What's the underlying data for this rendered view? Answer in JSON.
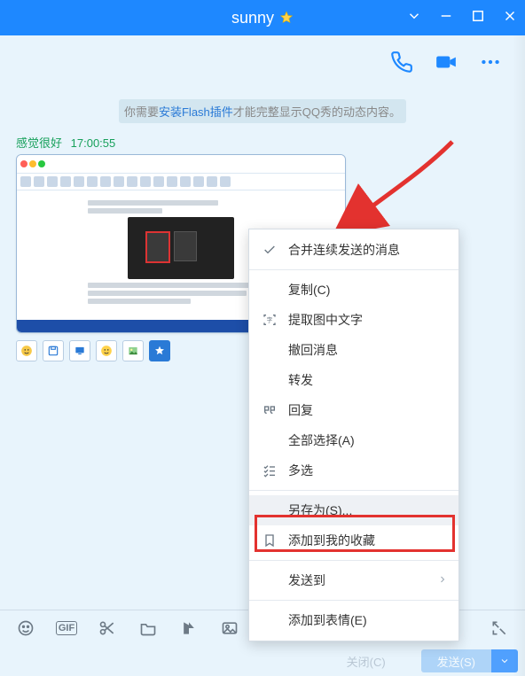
{
  "title": "sunny",
  "notice": {
    "pre": "你需要",
    "link": "安装Flash插件",
    "post": "才能完整显示QQ秀的动态内容。"
  },
  "message": {
    "sender": "感觉很好",
    "time": "17:00:55"
  },
  "ctx": {
    "merge": "合并连续发送的消息",
    "copy": "复制(C)",
    "ocr": "提取图中文字",
    "recall": "撤回消息",
    "forward": "转发",
    "reply": "回复",
    "selectall": "全部选择(A)",
    "multiselect": "多选",
    "saveas": "另存为(S)...",
    "fav": "添加到我的收藏",
    "sendto": "发送到",
    "emoji": "添加到表情(E)"
  },
  "send": {
    "close": "关闭(C)",
    "send": "发送(S)"
  }
}
